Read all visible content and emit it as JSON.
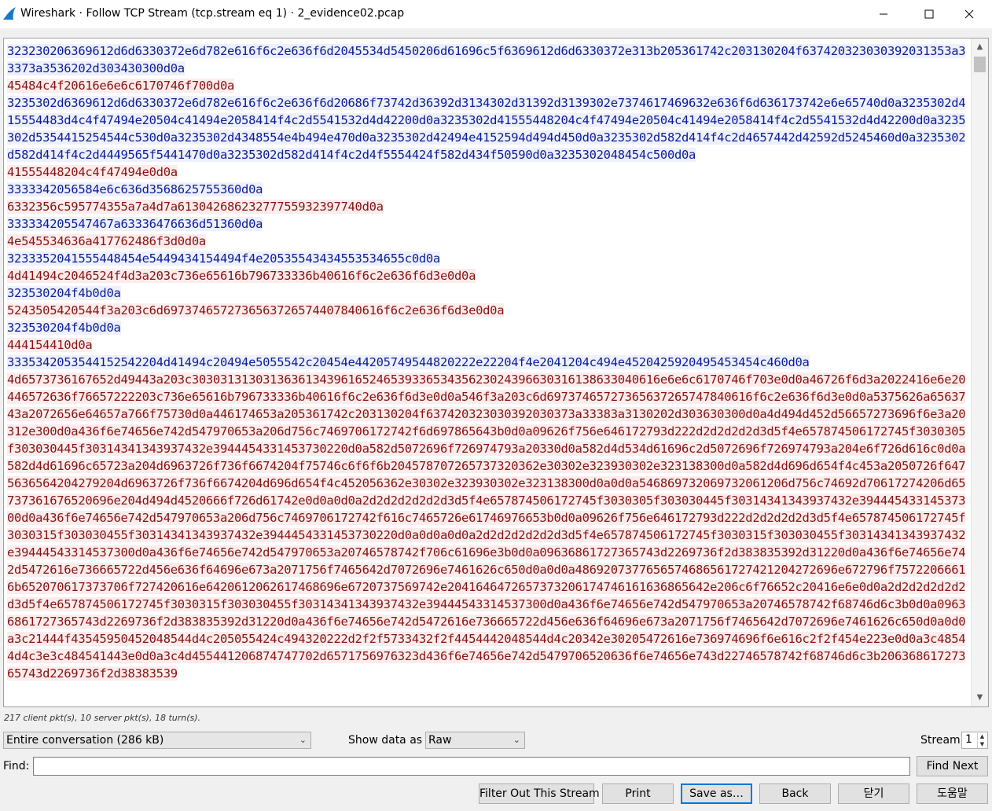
{
  "window": {
    "title": "Wireshark · Follow TCP Stream (tcp.stream eq 1) · 2_evidence02.pcap",
    "controls": {
      "minimize": "minimize-icon",
      "maximize": "maximize-icon",
      "close": "close-icon"
    }
  },
  "colors": {
    "server_text": "#0b1d96",
    "server_bg": "#eef0fc",
    "client_text": "#861313",
    "client_bg": "#fcecec"
  },
  "stream": {
    "segments": [
      {
        "dir": "server",
        "text": "323230206369612d6d6330372e6d782e616f6c2e636f6d2045534d5450206d61696c5f6369612d6d6330372e313b205361742c203130204f6374203230 30392031353a33373a3536202d303430300d0a"
      },
      {
        "dir": "client",
        "text": "45484c4f20616e6e6c6170746f700d0a"
      },
      {
        "dir": "server",
        "text": "3235302d6369612d6d6330372e6d782e616f6c2e636f6d20686f73742d36392d3134302d31392d3139302e7374617469632e636f6d636173742e6e6574 0d0a3235302d415554483d4c4f47494e20504c41494e2058414f4c2d5541532d4d42200d0a3235302d41555448204c4f47494e20504c41494e2058414f 4c2d5541532d4d42200d0a3235302d5354415254544c530d0a3235302d4348554e4b494e470d0a3235302d42494e4152594d494d450d0a3235302d582d 414f4c2d4657442d42592d5245460d0a3235302d582d414f4c2d4449565f5441470d0a3235302d582d414f4c2d4f5554424f582d434f50590d0a323530 2048454c500d0a"
      },
      {
        "dir": "client",
        "text": "41555448204c4f47494e0d0a"
      },
      {
        "dir": "server",
        "text": "3333342056584e6c636d3568625755360d0a"
      },
      {
        "dir": "client",
        "text": "6332356c595774355a7a4d7a61304268623277755932397740d0a"
      },
      {
        "dir": "server",
        "text": "333334205547467a63336476636d51360d0a"
      },
      {
        "dir": "client",
        "text": "4e545534636a417762486f3d0d0a"
      },
      {
        "dir": "server",
        "text": "3233352041555448454e5449434154494f4e20535543434553534655c0d0a"
      },
      {
        "dir": "client",
        "text": "4d41494c2046524f4d3a203c736e65616b796733336b40616f6c2e636f6d3e0d0a"
      },
      {
        "dir": "server",
        "text": "323530204f4b0d0a"
      },
      {
        "dir": "client",
        "text": "5243505420544f3a203c6d6973746572736563726574407840616f6c2e636f6d3e0d0a"
      },
      {
        "dir": "server",
        "text": "323530204f4b0d0a"
      },
      {
        "dir": "client",
        "text": "444154410d0a"
      },
      {
        "dir": "server",
        "text": "3335342053544152542204d41494c20494e5055542c20454e44205749544820222e22204f4e2041204c494e4520425920495453454c460d0a"
      },
      {
        "dir": "client",
        "text": "4d6573736167652d49443a203c30303131303136361343961652465393365343562302439663031613863304061 6e6e6c6170746f703e0d0a46726f6d3a 2022416e6e20446572636f76657222203c736e65616b796733336b40616f6c2e636f6d3e0d0a546f3a203c6d69737465727365637265747840616f6c2e 636f6d3e0d0a5375626a6563743a2072656e64657a766f75730d0a446174653a205361742c203130204f63742032303039203037 3a33383a3130202d30 3630300d0a4d494d452d56657273696f6e3a20312e300d0a436f6e74656e742d547970653a206d756c7469706172742f6d697865643b0d0a09626f756e 646172793d222d2d2d2d2d3d5f4e657874506172745f3030305f303030445f30314341343937432e3944454331453730220d0a582d5072696f726974793a 20330d0a582d4d534d61696c2d5072696f726974793a204e6f726d616c0d0a582d4d61696c65723a204d6963726f736f6674204f75746c6f6f6b204578 707265737320362e30302e323930302e323138300d0a582d4d696d654f4c453a2050726f647563656420427920 4d6963726f736f6674204d696d654f4c 452056362e30302e323930302e323138300d0a0d0a5468697320697320612 06d756c74692d70617274206d657373616765 20696e204d494d4520666f72 6d61742e0d0a0d0a2d2d2d2d2d2d3d5f4e657874506172745f3030305f303030445f30314341343937432e39444543314537300d0a436f6e74656e742d 547970653a206d756c7469706172742f616c7465726e6174697665 3b0d0a09626f756e646172793d222d2d2d2d2d3d5f4e657874506172745f3030315f30 3030455f30314341343937432e39444543314537 30220d0a0d0a0d0a2d2d2d2d2d2d3d5f4e657874506172745f3030315f303030455f30314341343937 432e39444543314537300d0a436f6e74656e742d547970653a20746578742f706c61696e3b0d0a0963686172736574 3d2269736f2d383835392d31220d 0a436f6e74656e742d5472616e736665722d456e636f64696e673a2071756f7465642d7072696e7461626c650d0a0d0a48692073776565746865617274 21204272696e672796f75722066616b652070617373706f727420616e642061206261746869 6e6720737569742e20416464726573732061747461 6163686564 2e206c6f76652c20416e6e0d0a2d2d2d2d2d2d3d5f4e657874506172745f3030315f303030455f30314341343937432e39444543 314537 300d0a436f6e74656e742d547970653a20746578742f68746d6c3b0d0a09636861727365743d2269736f2d383835392d31220d0a436f6e74656e742d5472 616e736665722d456e636f64696e673a2071756f7465642d7072696e7461626c650d0a0d0a3c21444f43545950452048544d4c205055424c494320222d 2f2f5733432f2f4454442048544d4c20342e30205472616e736974696f6e616c2f2f454e223e0d0a3c48544d4c3e3c484541443e0d0a3c4d4554412068 74747702d6571756976323d436f6e74656e742d547970652063 6f6e74656e743d22746578742f68746d6c3b20636861727365743d2269736f2d38383539"
      }
    ]
  },
  "status_line": "217 client pkt(s), 10 server pkt(s), 18 turn(s).",
  "conversation_select": {
    "value": "Entire conversation (286 kB)"
  },
  "show_data": {
    "label": "Show data as",
    "value": "Raw"
  },
  "stream_spin": {
    "label": "Stream",
    "value": "1"
  },
  "find": {
    "label": "Find:",
    "value": "",
    "next_button": "Find Next"
  },
  "buttons": {
    "filter_out": "Filter Out This Stream",
    "print": "Print",
    "save_as": "Save as…",
    "back": "Back",
    "close": "닫기",
    "help": "도움말"
  }
}
